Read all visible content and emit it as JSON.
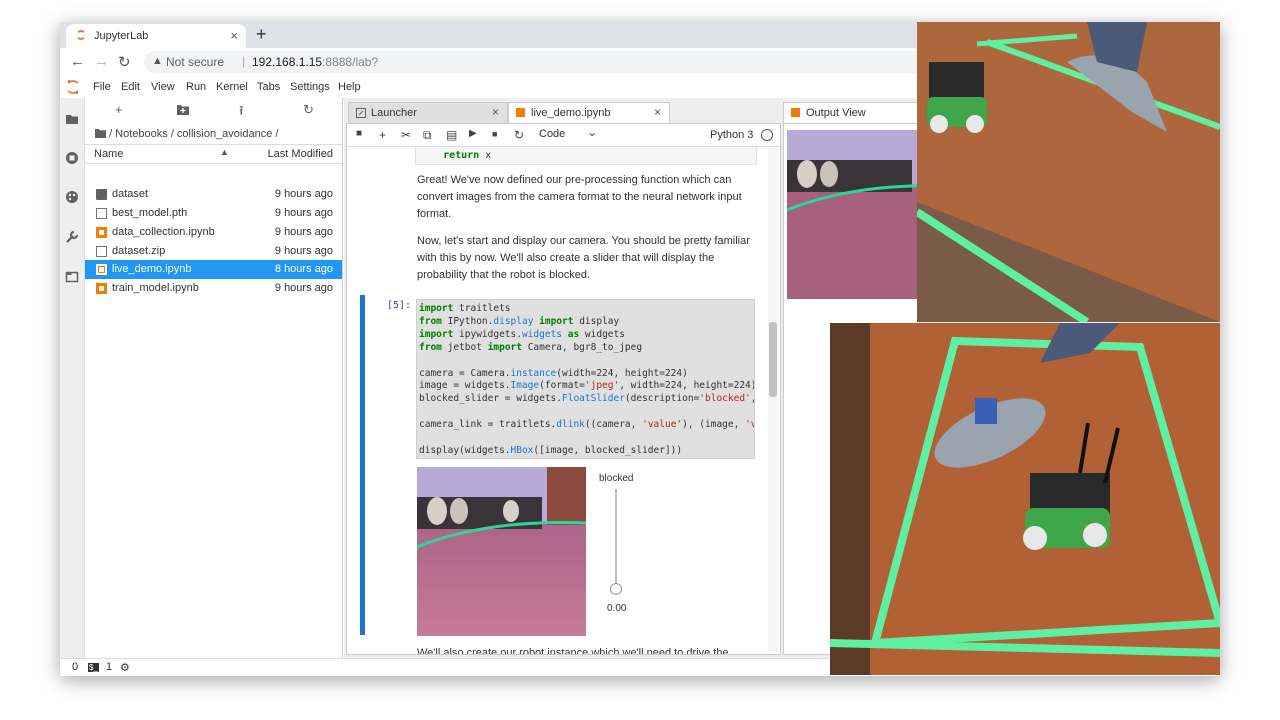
{
  "browser": {
    "tab_title": "JupyterLab",
    "tab_close": "×",
    "new_tab": "+",
    "back": "←",
    "forward": "→",
    "reload": "↻",
    "security_icon": "▲",
    "security_text": "Not secure",
    "url_host": "192.168.1.15",
    "url_rest": ":8888/lab?"
  },
  "menubar": {
    "items": [
      "File",
      "Edit",
      "View",
      "Run",
      "Kernel",
      "Tabs",
      "Settings",
      "Help"
    ]
  },
  "filebrowser": {
    "toolbar": {
      "new": "+",
      "new_folder": "▪",
      "upload": "⭱",
      "refresh": "↻"
    },
    "breadcrumb": "/ Notebooks / collision_avoidance /",
    "header_name": "Name",
    "header_sort": "▲",
    "header_modified": "Last Modified",
    "files": [
      {
        "name": "dataset",
        "time": "9 hours ago",
        "type": "folder"
      },
      {
        "name": "best_model.pth",
        "time": "9 hours ago",
        "type": "file"
      },
      {
        "name": "data_collection.ipynb",
        "time": "9 hours ago",
        "type": "notebook"
      },
      {
        "name": "dataset.zip",
        "time": "9 hours ago",
        "type": "file"
      },
      {
        "name": "live_demo.ipynb",
        "time": "8 hours ago",
        "type": "notebook"
      },
      {
        "name": "train_model.ipynb",
        "time": "9 hours ago",
        "type": "notebook"
      }
    ]
  },
  "tabs": {
    "launcher": "Launcher",
    "notebook": "live_demo.ipynb",
    "output": "Output View",
    "close": "×"
  },
  "toolbar": {
    "save": "■",
    "add": "+",
    "cut": "✂",
    "copy": "⧉",
    "paste": "▤",
    "run": "▶",
    "stop": "■",
    "restart": "↻",
    "cell_type": "Code",
    "cell_type_caret": "⌄",
    "kernel": "Python 3"
  },
  "notebook": {
    "prev_code": "    return x",
    "md1": "Great! We've now defined our pre-processing function which can convert images from the camera format to the neural network input format.",
    "md2": "Now, let's start and display our camera. You should be pretty familiar with this by now. We'll also create a slider that will display the probability that the robot is blocked.",
    "prompt": "[5]:",
    "slider_label": "blocked",
    "slider_value": "0.00",
    "slider_level": 0,
    "md3": "We'll also create our robot instance which we'll need to drive the"
  },
  "statusbar": {
    "left_count": "0",
    "terminal_icon": "$_",
    "terminals": "1",
    "gear": "⚙"
  },
  "colors": {
    "accent": "#2196f3",
    "jupyter_orange": "#f37726",
    "cell_bar": "#1976d2",
    "tape_green": "#5ef0a0",
    "table_wood": "#b8653a"
  },
  "icons": [
    "folder-icon",
    "circle-stop-icon",
    "palette-icon",
    "wrench-icon",
    "tabs-icon"
  ]
}
